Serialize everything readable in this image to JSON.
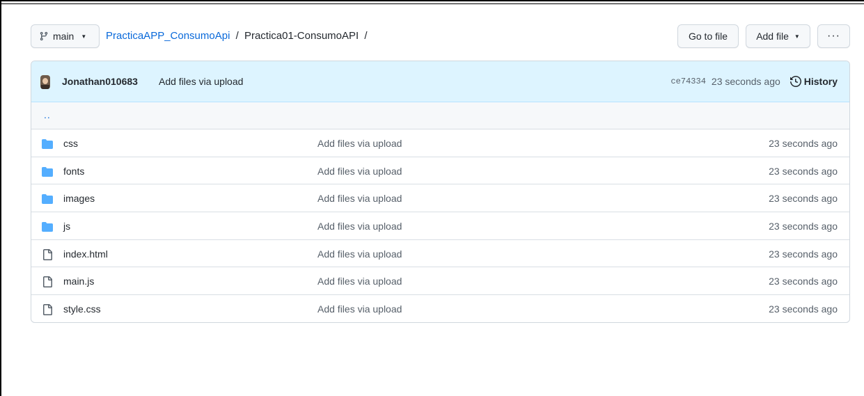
{
  "colors": {
    "link": "#0969da",
    "folder": "#54aeff",
    "commit_bg": "#ddf4ff",
    "border": "#d0d7de"
  },
  "branch": {
    "icon": "git-branch-icon",
    "label": "main"
  },
  "breadcrumb": {
    "repo": "PracticaAPP_ConsumoApi",
    "separator": "/",
    "folder": "Practica01-ConsumoAPI",
    "trailing": "/"
  },
  "actions": {
    "go_to_file": "Go to file",
    "add_file": "Add file",
    "more": "···"
  },
  "commit": {
    "author": "Jonathan010683",
    "message": "Add files via upload",
    "sha": "ce74334",
    "time": "23 seconds ago",
    "history_label": "History"
  },
  "parent_dir": "..",
  "files": [
    {
      "type": "dir",
      "name": "css",
      "message": "Add files via upload",
      "age": "23 seconds ago"
    },
    {
      "type": "dir",
      "name": "fonts",
      "message": "Add files via upload",
      "age": "23 seconds ago"
    },
    {
      "type": "dir",
      "name": "images",
      "message": "Add files via upload",
      "age": "23 seconds ago"
    },
    {
      "type": "dir",
      "name": "js",
      "message": "Add files via upload",
      "age": "23 seconds ago"
    },
    {
      "type": "file",
      "name": "index.html",
      "message": "Add files via upload",
      "age": "23 seconds ago"
    },
    {
      "type": "file",
      "name": "main.js",
      "message": "Add files via upload",
      "age": "23 seconds ago"
    },
    {
      "type": "file",
      "name": "style.css",
      "message": "Add files via upload",
      "age": "23 seconds ago"
    }
  ]
}
